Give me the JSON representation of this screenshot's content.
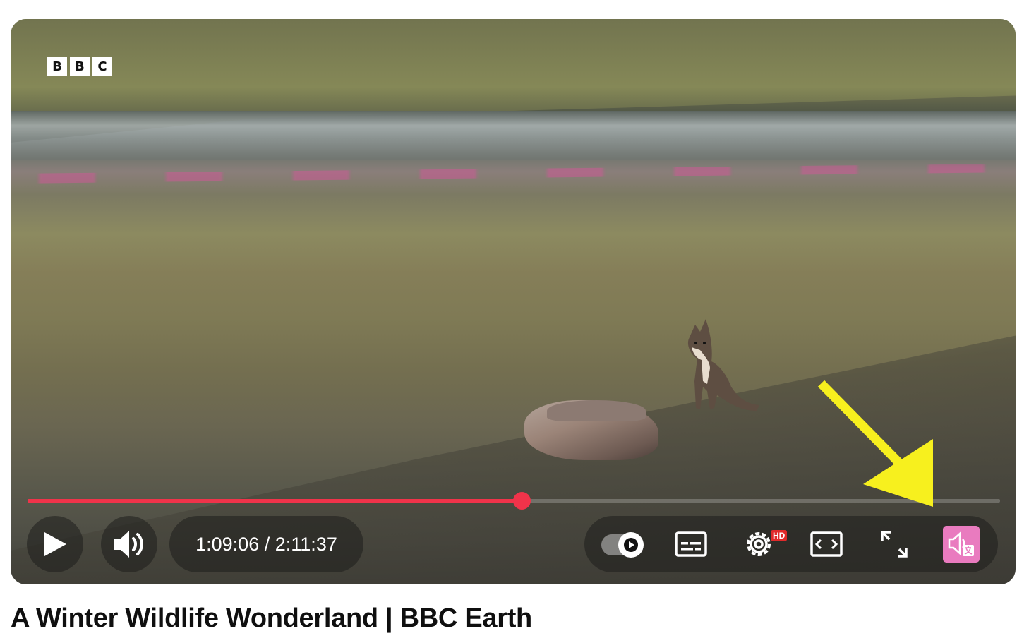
{
  "player": {
    "logo_letters": [
      "B",
      "B",
      "C"
    ],
    "progress_fraction": 0.508,
    "time_current": "1:09:06",
    "time_separator": "/",
    "time_total": "2:11:37",
    "settings_badge": "HD",
    "accent_color": "#f0334a",
    "highlight_color": "#e97bbf",
    "annotation_arrow_color": "#f7f01e"
  },
  "controls": {
    "icons": [
      "play-icon",
      "volume-icon",
      "autoplay-toggle",
      "subtitles-icon",
      "settings-icon",
      "theater-mode-icon",
      "fullscreen-icon",
      "voice-translate-icon"
    ]
  },
  "video": {
    "title": "A Winter Wildlife Wonderland | BBC Earth"
  }
}
